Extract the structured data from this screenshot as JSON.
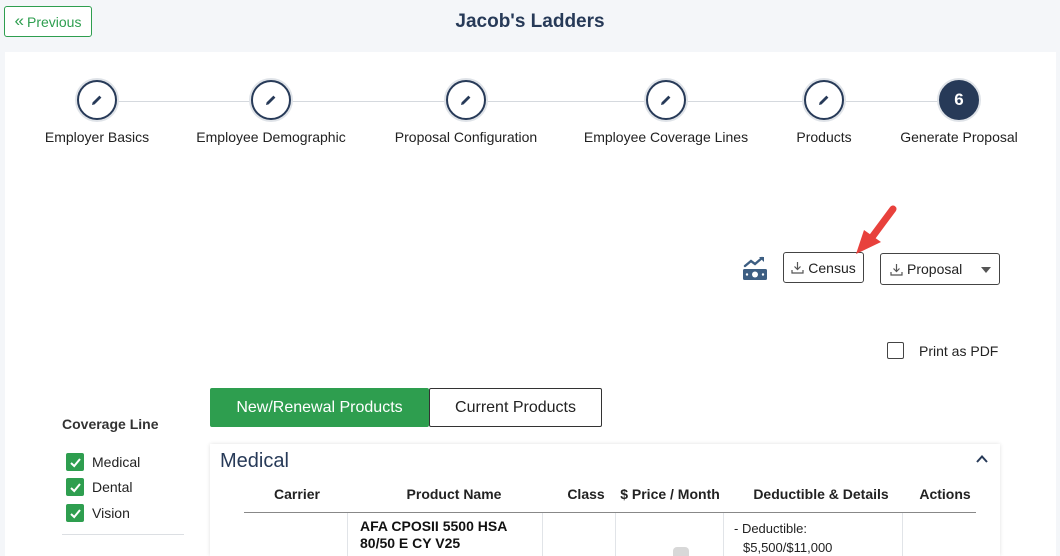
{
  "header": {
    "previous_label": "Previous",
    "title": "Jacob's Ladders"
  },
  "stepper": {
    "steps": [
      {
        "label": "Employer Basics",
        "state": "done"
      },
      {
        "label": "Employee Demographic",
        "state": "done"
      },
      {
        "label": "Proposal Configuration",
        "state": "done"
      },
      {
        "label": "Employee Coverage Lines",
        "state": "done"
      },
      {
        "label": "Products",
        "state": "done"
      },
      {
        "label": "Generate Proposal",
        "state": "active",
        "number": "6"
      }
    ]
  },
  "actions": {
    "census_label": "Census",
    "proposal_label": "Proposal",
    "print_pdf_label": "Print as PDF",
    "print_pdf_checked": false
  },
  "coverage": {
    "title": "Coverage Line",
    "items": [
      {
        "label": "Medical",
        "checked": true
      },
      {
        "label": "Dental",
        "checked": true
      },
      {
        "label": "Vision",
        "checked": true
      }
    ]
  },
  "tabs": [
    {
      "label": "New/Renewal Products",
      "active": true
    },
    {
      "label": "Current Products",
      "active": false
    }
  ],
  "medical": {
    "title": "Medical",
    "columns": [
      "Carrier",
      "Product Name",
      "Class",
      "$ Price / Month",
      "Deductible & Details",
      "Actions"
    ],
    "rows": [
      {
        "carrier": "",
        "product_name": "AFA CPOSII 5500 HSA 80/50 E CY V25",
        "class": "",
        "price": "",
        "deductible_line1": "- Deductible:",
        "deductible_line2": "$5,500/$11,000"
      }
    ]
  },
  "colors": {
    "navy": "#273a58",
    "green": "#2e9e4f",
    "arrow_red": "#e8413c"
  },
  "icons": [
    "double-chevron-left-icon",
    "pencil-icon",
    "money-trend-icon",
    "download-icon",
    "chevron-up-icon",
    "checkmark-icon",
    "red-arrow-icon"
  ]
}
